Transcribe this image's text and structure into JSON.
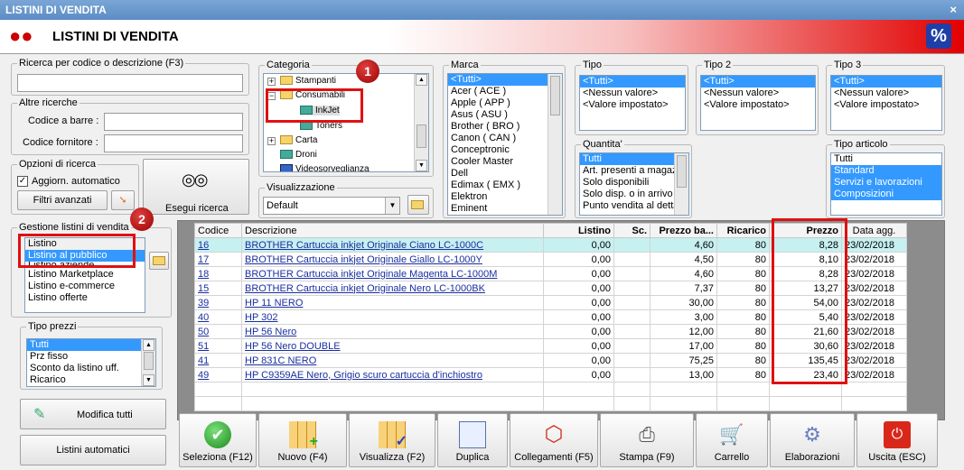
{
  "window_title": "LISTINI DI VENDITA",
  "header_title": "LISTINI DI VENDITA",
  "header_percent": "%",
  "close_glyph": "×",
  "search": {
    "title": "Ricerca per codice o descrizione (F3)",
    "value": ""
  },
  "other": {
    "title": "Altre ricerche",
    "barcode_label": "Codice a barre :",
    "supplier_label": "Codice fornitore :"
  },
  "options": {
    "title": "Opzioni di ricerca",
    "auto_label": "Aggiorn. automatico",
    "filters_label": "Filtri avanzati",
    "run_label": "Esegui ricerca"
  },
  "category": {
    "title": "Categoria",
    "nodes": [
      "Stampanti",
      "Consumabili",
      "InkJet",
      "Toners",
      "Carta",
      "Droni",
      "Videosorveglianza"
    ]
  },
  "view": {
    "title": "Visualizzazione",
    "value": "Default"
  },
  "marca": {
    "title": "Marca",
    "items": [
      "<Tutti>",
      "Acer ( ACE )",
      "Apple ( APP )",
      "Asus ( ASU )",
      "Brother ( BRO )",
      "Canon ( CAN )",
      "Conceptronic",
      "Cooler Master",
      "Dell",
      "Edimax ( EMX )",
      "Elektron",
      "Eminent"
    ]
  },
  "tipo": {
    "title": "Tipo",
    "items": [
      "<Tutti>",
      "<Nessun valore>",
      "<Valore impostato>"
    ]
  },
  "tipo2": {
    "title": "Tipo 2",
    "items": [
      "<Tutti>",
      "<Nessun valore>",
      "<Valore impostato>"
    ]
  },
  "tipo3": {
    "title": "Tipo 3",
    "items": [
      "<Tutti>",
      "<Nessun valore>",
      "<Valore impostato>"
    ]
  },
  "quantita": {
    "title": "Quantita'",
    "items": [
      "Tutti",
      "Art. presenti a magazzino",
      "Solo disponibili",
      "Solo disp. o in arrivo",
      "Punto vendita al dettaglio"
    ]
  },
  "tipo_articolo": {
    "title": "Tipo articolo",
    "items": [
      "Tutti",
      "Standard",
      "Servizi e lavorazioni",
      "Composizioni"
    ]
  },
  "gestione": {
    "title": "Gestione listini di vendita",
    "header": "Listino",
    "items": [
      "Listino al pubblico",
      "Listino aziende",
      "Listino Marketplace",
      "Listino e-commerce",
      "Listino offerte"
    ]
  },
  "tipo_prezzi": {
    "title": "Tipo prezzi",
    "items": [
      "Tutti",
      "Prz fisso",
      "Sconto da listino uff.",
      "Ricarico"
    ]
  },
  "modifica_label": "Modifica tutti",
  "automatici_label": "Listini automatici",
  "badges": [
    "1",
    "2"
  ],
  "columns": [
    "Codice",
    "Descrizione",
    "Listino",
    "Sc.",
    "Prezzo ba...",
    "Ricarico",
    "Prezzo",
    "Data agg."
  ],
  "rows": [
    {
      "codice": "16",
      "desc": "BROTHER Cartuccia inkjet Originale Ciano LC-1000C",
      "listino": "0,00",
      "sc": "",
      "base": "4,60",
      "ricarico": "80",
      "prezzo": "8,28",
      "data": "23/02/2018"
    },
    {
      "codice": "17",
      "desc": "BROTHER Cartuccia inkjet Originale Giallo LC-1000Y",
      "listino": "0,00",
      "sc": "",
      "base": "4,50",
      "ricarico": "80",
      "prezzo": "8,10",
      "data": "23/02/2018"
    },
    {
      "codice": "18",
      "desc": "BROTHER Cartuccia inkjet Originale Magenta LC-1000M",
      "listino": "0,00",
      "sc": "",
      "base": "4,60",
      "ricarico": "80",
      "prezzo": "8,28",
      "data": "23/02/2018"
    },
    {
      "codice": "15",
      "desc": "BROTHER Cartuccia inkjet Originale Nero LC-1000BK",
      "listino": "0,00",
      "sc": "",
      "base": "7,37",
      "ricarico": "80",
      "prezzo": "13,27",
      "data": "23/02/2018"
    },
    {
      "codice": "39",
      "desc": "HP 11 NERO",
      "listino": "0,00",
      "sc": "",
      "base": "30,00",
      "ricarico": "80",
      "prezzo": "54,00",
      "data": "23/02/2018"
    },
    {
      "codice": "40",
      "desc": "HP 302",
      "listino": "0,00",
      "sc": "",
      "base": "3,00",
      "ricarico": "80",
      "prezzo": "5,40",
      "data": "23/02/2018"
    },
    {
      "codice": "50",
      "desc": "HP 56 Nero",
      "listino": "0,00",
      "sc": "",
      "base": "12,00",
      "ricarico": "80",
      "prezzo": "21,60",
      "data": "23/02/2018"
    },
    {
      "codice": "51",
      "desc": "HP 56 Nero DOUBLE",
      "listino": "0,00",
      "sc": "",
      "base": "17,00",
      "ricarico": "80",
      "prezzo": "30,60",
      "data": "23/02/2018"
    },
    {
      "codice": "41",
      "desc": "HP 831C NERO",
      "listino": "0,00",
      "sc": "",
      "base": "75,25",
      "ricarico": "80",
      "prezzo": "135,45",
      "data": "23/02/2018"
    },
    {
      "codice": "49",
      "desc": "HP C9359AE Nero, Grigio scuro cartuccia d'inchiostro",
      "listino": "0,00",
      "sc": "",
      "base": "13,00",
      "ricarico": "80",
      "prezzo": "23,40",
      "data": "23/02/2018"
    }
  ],
  "toolbar": [
    "Seleziona (F12)",
    "Nuovo (F4)",
    "Visualizza (F2)",
    "Duplica",
    "Collegamenti (F5)",
    "Stampa (F9)",
    "Carrello",
    "Elaborazioni",
    "Uscita (ESC)"
  ],
  "colors": {
    "accent": "#3399ff",
    "highlight": "#e01010",
    "link": "#1a2fa0"
  }
}
